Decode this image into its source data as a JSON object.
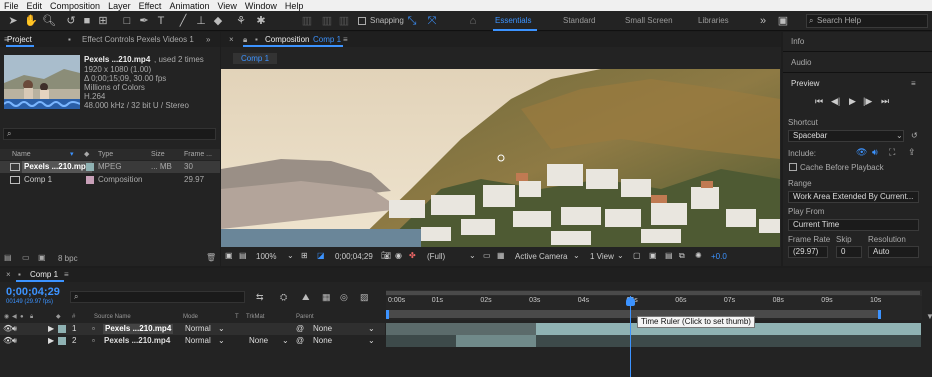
{
  "menubar": [
    "File",
    "Edit",
    "Composition",
    "Layer",
    "Effect",
    "Animation",
    "View",
    "Window",
    "Help"
  ],
  "toolbar": {
    "snapping_label": "Snapping",
    "workspaces": [
      "Essentials",
      "Standard",
      "Small Screen",
      "Libraries"
    ],
    "active_workspace": "Essentials",
    "search_placeholder": "Search Help"
  },
  "project": {
    "tab_project": "Project",
    "tab_effect_controls": "Effect Controls Pexels Videos 1",
    "file_name": "Pexels ...210.mp4",
    "file_used": ", used 2 times",
    "info_lines": [
      "1920 x 1080 (1.00)",
      "Δ 0;00;15;09, 30.00 fps",
      "Millions of Colors",
      "H.264",
      "48.000 kHz / 32 bit U / Stereo"
    ],
    "search_placeholder": "",
    "columns": [
      "Name",
      "Type",
      "Size",
      "Frame ..."
    ],
    "items": [
      {
        "name": "Pexels ...210.mp4",
        "type": "MPEG",
        "size": "... MB",
        "fps": "30",
        "color": "#8fb2b3"
      },
      {
        "name": "Comp 1",
        "type": "Composition",
        "size": "",
        "fps": "29.97",
        "color": "#c8a0b8"
      }
    ],
    "bpc": "8 bpc"
  },
  "composition": {
    "tab_label": "Composition",
    "comp_name": "Comp 1",
    "sub_tab": "Comp 1",
    "zoom": "100%",
    "timecode": "0;00;04;29",
    "resolution": "(Full)",
    "camera": "Active Camera",
    "views": "1 View",
    "exposure": "+0.0"
  },
  "right_panel": {
    "info": "Info",
    "audio": "Audio",
    "preview": "Preview",
    "shortcut_label": "Shortcut",
    "shortcut_value": "Spacebar",
    "include_label": "Include:",
    "cache_label": "Cache Before Playback",
    "range_label": "Range",
    "range_value": "Work Area Extended By Current...",
    "play_from_label": "Play From",
    "play_from_value": "Current Time",
    "frame_rate_label": "Frame Rate",
    "skip_label": "Skip",
    "resolution_label": "Resolution",
    "frame_rate_value": "(29.97)",
    "skip_value": "0",
    "resolution_value": "Auto"
  },
  "timeline": {
    "tab_label": "Comp 1",
    "timecode": "0;00;04;29",
    "timecode_sub": "00149 (29.97 fps)",
    "columns": {
      "num": "#",
      "source": "Source Name",
      "mode": "Mode",
      "t": "T",
      "trkmat": "TrkMat",
      "parent": "Parent"
    },
    "layers": [
      {
        "num": "1",
        "name": "Pexels ...210.mp4",
        "mode": "Normal",
        "trkmat": "",
        "parent": "None"
      },
      {
        "num": "2",
        "name": "Pexels ...210.mp4",
        "mode": "Normal",
        "trkmat": "None",
        "parent": "None"
      }
    ],
    "ruler_ticks": [
      "0:00s",
      "01s",
      "02s",
      "03s",
      "04s",
      "05s",
      "06s",
      "07s",
      "08s",
      "09s",
      "10s"
    ],
    "current_time_seconds": 4.97,
    "tooltip": "Time Ruler (Click to set thumb)"
  },
  "colors": {
    "accent": "#3c93ff",
    "panel": "#232323",
    "track": "#8fb2b3",
    "timecode": "#3c93ff"
  }
}
